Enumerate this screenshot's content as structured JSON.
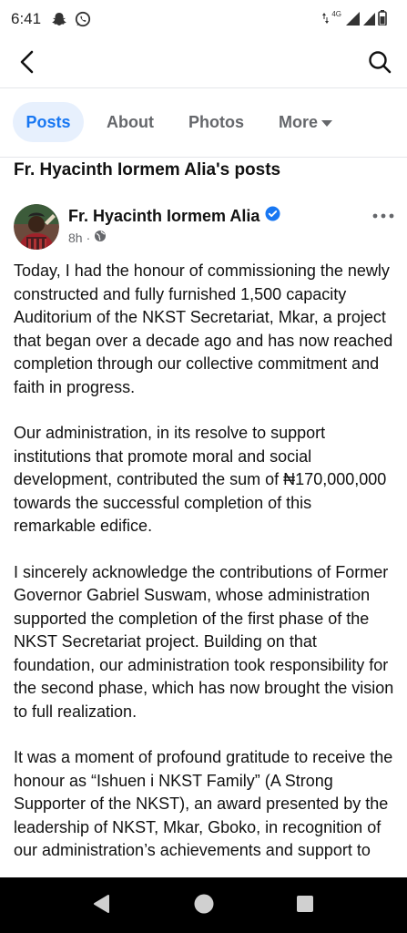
{
  "status_bar": {
    "time": "6:41",
    "network": "4G",
    "icons": [
      "snapchat-ghost-icon",
      "whatsapp-icon",
      "data-arrows-icon",
      "signal-icon",
      "battery-icon"
    ]
  },
  "app_bar": {
    "icons": [
      "back-arrow-icon",
      "search-icon"
    ]
  },
  "tabs": [
    {
      "label": "Posts",
      "active": true
    },
    {
      "label": "About",
      "active": false
    },
    {
      "label": "Photos",
      "active": false
    },
    {
      "label": "More",
      "active": false
    }
  ],
  "section_title": "Fr. Hyacinth Iormem Alia's posts",
  "post": {
    "author": "Fr. Hyacinth Iormem Alia",
    "verified": true,
    "time": "8h",
    "separator": "·",
    "audience_icon": "globe-icon",
    "paragraphs": [
      "Today, I had the honour of commissioning the newly constructed and fully furnished 1,500 capacity Auditorium of the NKST Secretariat, Mkar, a project that began over a decade ago and has now reached completion through our collective commitment and faith in progress.",
      "Our administration, in its resolve to support institutions that promote moral and social development, contributed the sum of ₦170,000,000 towards the successful completion of this remarkable edifice.",
      "I sincerely acknowledge the contributions of Former Governor Gabriel Suswam, whose administration supported the completion of the first phase of the NKST Secretariat project. Building on that foundation, our administration took responsibility for the second phase, which has now brought the vision to full realization.",
      "It was a moment of profound gratitude to receive the honour as “Ishuen i NKST Family” (A Strong Supporter of the NKST), an award presented by the leadership of NKST, Mkar, Gboko, in recognition of our administration’s achievements and support to"
    ]
  },
  "nav_bar": {
    "icons": [
      "back-triangle-icon",
      "home-circle-icon",
      "recents-square-icon"
    ]
  },
  "colors": {
    "accent": "#1877f2",
    "tab_active_bg": "#e7f0fd",
    "muted_text": "#65676b",
    "nav_bar_bg": "#000000"
  }
}
